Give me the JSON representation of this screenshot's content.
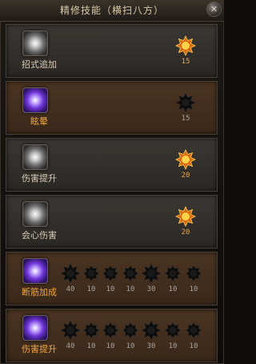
{
  "window": {
    "title": "精修技能（横扫八方）",
    "close_label": "✕"
  },
  "rows": [
    {
      "skill_name": "招式追加",
      "style": "gray",
      "gems": [
        {
          "value": "15",
          "active": true
        }
      ]
    },
    {
      "skill_name": "眩晕",
      "style": "brown",
      "gems": [
        {
          "value": "15",
          "active": false
        }
      ]
    },
    {
      "skill_name": "伤害提升",
      "style": "gray",
      "gems": [
        {
          "value": "20",
          "active": true
        }
      ]
    },
    {
      "skill_name": "会心伤害",
      "style": "gray",
      "gems": [
        {
          "value": "20",
          "active": true
        }
      ]
    },
    {
      "skill_name": "断筋加成",
      "style": "brown",
      "gems": [
        {
          "value": "40",
          "active": false
        },
        {
          "value": "10",
          "active": false
        },
        {
          "value": "10",
          "active": false
        },
        {
          "value": "10",
          "active": false
        },
        {
          "value": "30",
          "active": false
        },
        {
          "value": "10",
          "active": false
        },
        {
          "value": "10",
          "active": false
        }
      ]
    },
    {
      "skill_name": "伤害提升",
      "style": "brown",
      "gems": [
        {
          "value": "40",
          "active": false
        },
        {
          "value": "10",
          "active": false
        },
        {
          "value": "10",
          "active": false
        },
        {
          "value": "10",
          "active": false
        },
        {
          "value": "30",
          "active": false
        },
        {
          "value": "10",
          "active": false
        },
        {
          "value": "10",
          "active": false
        }
      ]
    }
  ]
}
